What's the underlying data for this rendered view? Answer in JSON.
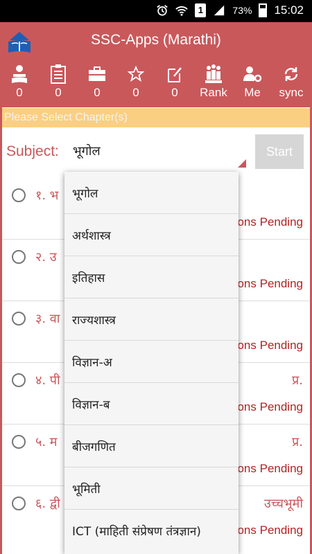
{
  "status_bar": {
    "battery_percent": "73%",
    "sim_slot": "1",
    "time": "15:02",
    "icons": [
      "alarm-icon",
      "wifi-icon",
      "sim-icon",
      "signal-icon",
      "battery-icon"
    ]
  },
  "app": {
    "title": "SSC-Apps (Marathi)",
    "accent_color": "#c9585b"
  },
  "toolbar": {
    "items": [
      {
        "icon": "reader-icon",
        "label": "0"
      },
      {
        "icon": "clipboard-icon",
        "label": "0"
      },
      {
        "icon": "briefcase-icon",
        "label": "0"
      },
      {
        "icon": "star-icon",
        "label": "0"
      },
      {
        "icon": "note-edit-icon",
        "label": "0"
      },
      {
        "icon": "rank-icon",
        "label": "Rank"
      },
      {
        "icon": "user-settings-icon",
        "label": "Me"
      },
      {
        "icon": "sync-icon",
        "label": "sync"
      }
    ]
  },
  "notice": "Please Select Chapter(s)",
  "subject": {
    "label": "Subject:",
    "selected": "भूगोल",
    "start_label": "Start"
  },
  "chapters": [
    {
      "title": "१. भ",
      "title_right": "",
      "status": "ons Pending"
    },
    {
      "title": "२. उ",
      "title_right": "",
      "status": "ons Pending"
    },
    {
      "title": "३. वा",
      "title_right": "",
      "status": "ons Pending"
    },
    {
      "title": "४. पी",
      "title_right": "प्र.",
      "status": "ons Pending"
    },
    {
      "title": "५. म",
      "title_right": "प्र.",
      "status": "ons Pending"
    },
    {
      "title": "६. द्वी",
      "title_right": "उच्चभूमी",
      "status": "ons Pending"
    }
  ],
  "dropdown": {
    "options": [
      "भूगोल",
      "अर्थशास्त्र",
      "इतिहास",
      "राज्यशास्त्र",
      "विज्ञान-अ",
      "विज्ञान-ब",
      "बीजगणित",
      "भूमिती",
      "ICT (माहिती संप्रेषण तंत्रज्ञान)"
    ]
  }
}
